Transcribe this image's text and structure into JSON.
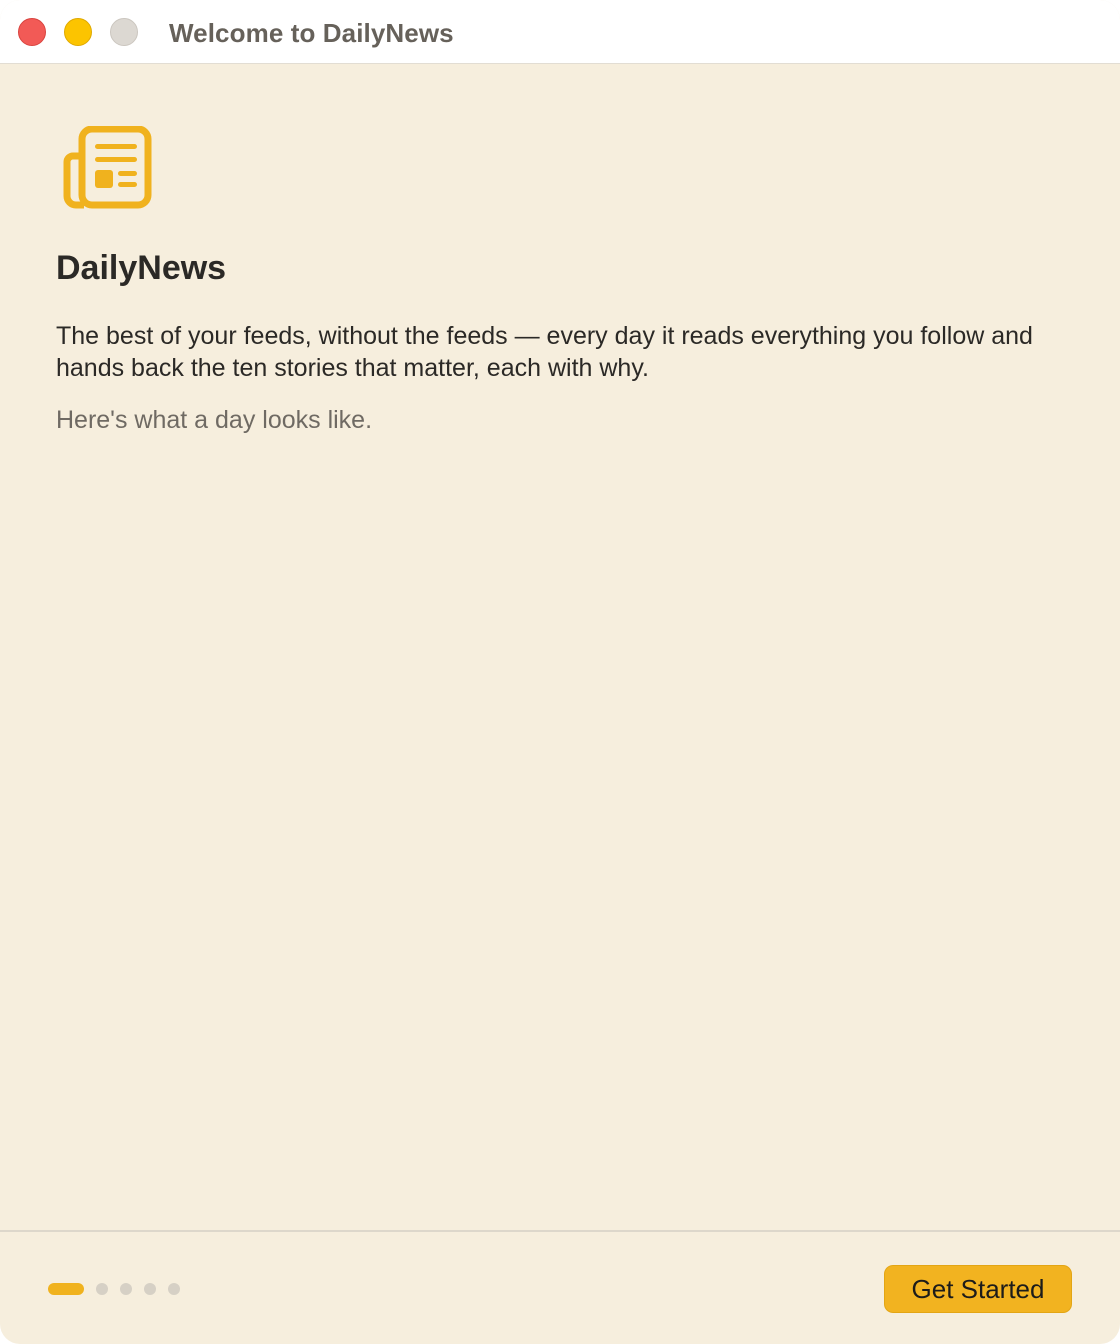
{
  "window": {
    "title": "Welcome to DailyNews"
  },
  "onboarding": {
    "icon": "newspaper-icon",
    "app_name": "DailyNews",
    "tagline": "The best of your feeds, without the feeds — every day it reads everything you follow and hands back the ten stories that matter, each with why.",
    "subnote": "Here's what a day looks like."
  },
  "footer": {
    "page_count": 5,
    "current_page": 1,
    "primary_button": "Get Started"
  },
  "colors": {
    "accent": "#f2b320",
    "background": "#f6eedd",
    "text": "#2b2926",
    "muted_text": "#6f6a63"
  }
}
